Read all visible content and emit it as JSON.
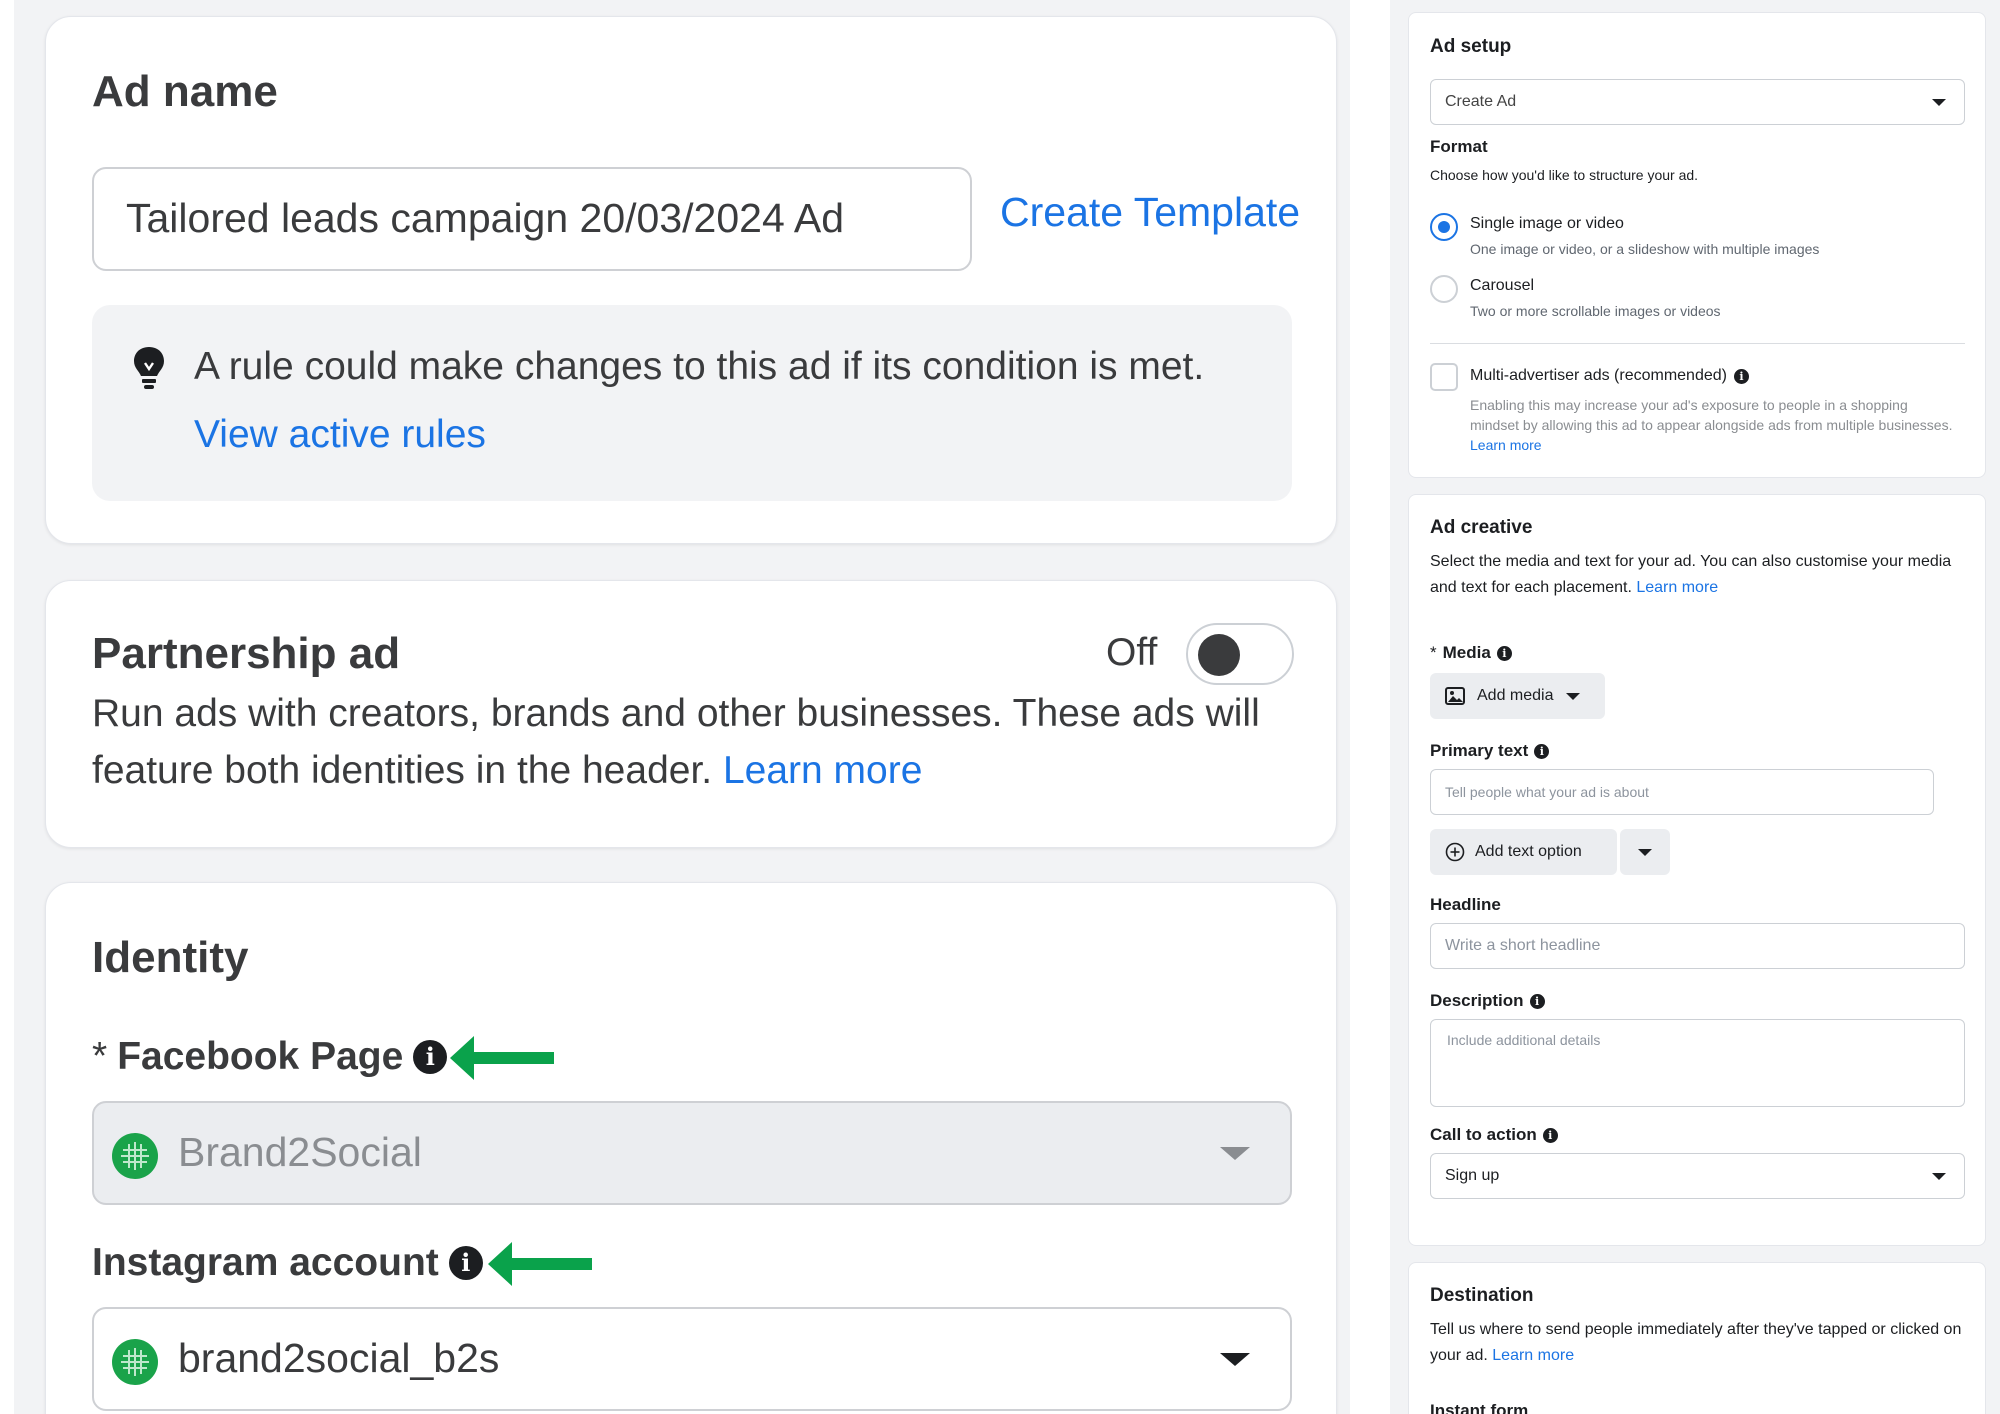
{
  "left": {
    "ad_name": {
      "title": "Ad name",
      "value": "Tailored leads campaign 20/03/2024 Ad",
      "create_template": "Create Template",
      "rule_text": "A rule could make changes to this ad if its condition is met.",
      "view_rules": "View active rules"
    },
    "partnership": {
      "title": "Partnership ad",
      "toggle_state": "Off",
      "description": "Run ads with creators, brands and other businesses. These ads will feature both identities in the header.",
      "learn_more": "Learn more"
    },
    "identity": {
      "title": "Identity",
      "required_mark": "*",
      "facebook_label": "Facebook Page",
      "facebook_value": "Brand2Social",
      "instagram_label": "Instagram account",
      "instagram_value": "brand2social_b2s"
    },
    "colors": {
      "annotation_arrow": "#0aa24b",
      "avatar": "#1aa34a",
      "link": "#1b74e4"
    }
  },
  "right": {
    "ad_setup": {
      "title": "Ad setup",
      "select_value": "Create Ad",
      "format_label": "Format",
      "format_help": "Choose how you'd like to structure your ad.",
      "options": [
        {
          "label": "Single image or video",
          "sub": "One image or video, or a slideshow with multiple images",
          "selected": true
        },
        {
          "label": "Carousel",
          "sub": "Two or more scrollable images or videos",
          "selected": false
        }
      ],
      "multi_label": "Multi-advertiser ads (recommended)",
      "multi_desc": "Enabling this may increase your ad's exposure to people in a shopping mindset by allowing this ad to appear alongside ads from multiple businesses.",
      "multi_learn": "Learn more"
    },
    "ad_creative": {
      "title": "Ad creative",
      "desc": "Select the media and text for your ad. You can also customise your media and text for each placement.",
      "learn_more": "Learn more",
      "media_label": "Media",
      "add_media": "Add media",
      "primary_label": "Primary text",
      "primary_placeholder": "Tell people what your ad is about",
      "add_text_option": "Add text option",
      "headline_label": "Headline",
      "headline_placeholder": "Write a short headline",
      "description_label": "Description",
      "description_placeholder": "Include additional details",
      "cta_label": "Call to action",
      "cta_value": "Sign up"
    },
    "destination": {
      "title": "Destination",
      "desc": "Tell us where to send people immediately after they've tapped or clicked on your ad.",
      "learn_more": "Learn more",
      "instant_form": "Instant form"
    }
  }
}
